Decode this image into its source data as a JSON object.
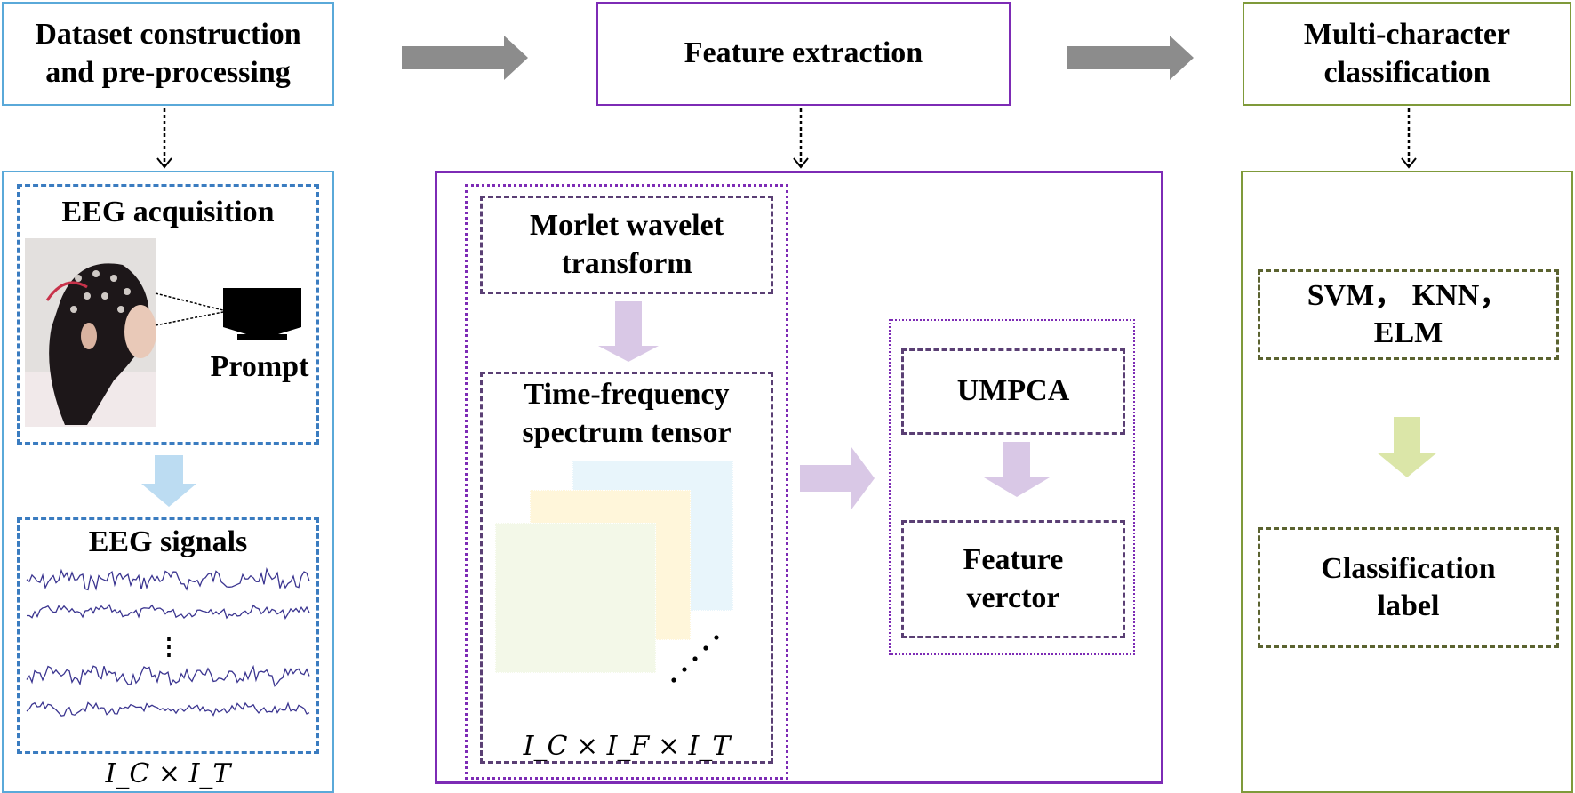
{
  "stages": {
    "dataset": "Dataset construction and pre-processing",
    "features": "Feature extraction",
    "classification": "Multi-character classification"
  },
  "acquisition": {
    "title": "EEG acquisition",
    "prompt": "Prompt"
  },
  "signals": {
    "title": "EEG signals",
    "ellipsis": "⋮",
    "dims": "I_C × I_T"
  },
  "morlet": "Morlet wavelet transform",
  "tensor": {
    "title": "Time-frequency spectrum tensor",
    "dims": "I_C × I_F × I_T"
  },
  "umpca": "UMPCA",
  "feature_vector": "Feature verctor",
  "classifiers": "SVM， KNN，ELM",
  "label": "Classification label",
  "colors": {
    "blue": "#5aa9d9",
    "dashblue": "#3a7cc0",
    "purple": "#7d2bb5",
    "dashpurple": "#5a3f74",
    "green": "#7f9a3a",
    "dashgreen": "#5b6330",
    "gray": "#8c8c8c",
    "arrowBlue": "#bcdcf2",
    "arrowPurple": "#d9c8e6",
    "arrowGreen": "#dbe6a8"
  }
}
